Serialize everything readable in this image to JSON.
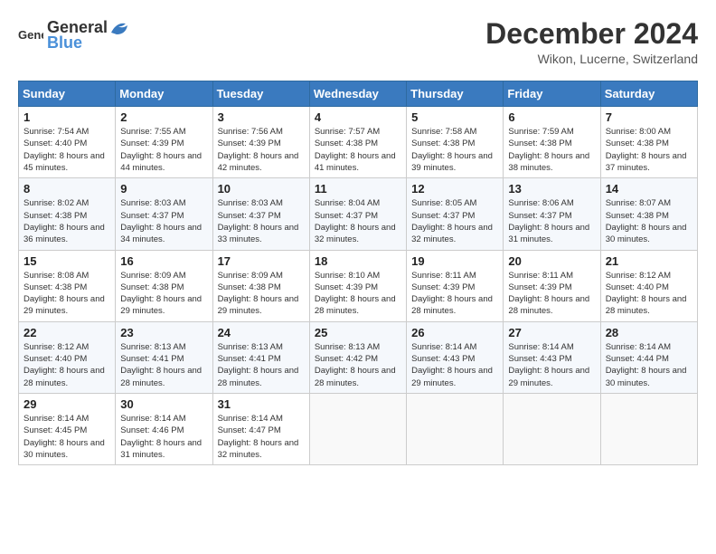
{
  "header": {
    "logo_general": "General",
    "logo_blue": "Blue",
    "month_title": "December 2024",
    "location": "Wikon, Lucerne, Switzerland"
  },
  "weekdays": [
    "Sunday",
    "Monday",
    "Tuesday",
    "Wednesday",
    "Thursday",
    "Friday",
    "Saturday"
  ],
  "weeks": [
    [
      {
        "day": "1",
        "sunrise": "7:54 AM",
        "sunset": "4:40 PM",
        "daylight": "8 hours and 45 minutes."
      },
      {
        "day": "2",
        "sunrise": "7:55 AM",
        "sunset": "4:39 PM",
        "daylight": "8 hours and 44 minutes."
      },
      {
        "day": "3",
        "sunrise": "7:56 AM",
        "sunset": "4:39 PM",
        "daylight": "8 hours and 42 minutes."
      },
      {
        "day": "4",
        "sunrise": "7:57 AM",
        "sunset": "4:38 PM",
        "daylight": "8 hours and 41 minutes."
      },
      {
        "day": "5",
        "sunrise": "7:58 AM",
        "sunset": "4:38 PM",
        "daylight": "8 hours and 39 minutes."
      },
      {
        "day": "6",
        "sunrise": "7:59 AM",
        "sunset": "4:38 PM",
        "daylight": "8 hours and 38 minutes."
      },
      {
        "day": "7",
        "sunrise": "8:00 AM",
        "sunset": "4:38 PM",
        "daylight": "8 hours and 37 minutes."
      }
    ],
    [
      {
        "day": "8",
        "sunrise": "8:02 AM",
        "sunset": "4:38 PM",
        "daylight": "8 hours and 36 minutes."
      },
      {
        "day": "9",
        "sunrise": "8:03 AM",
        "sunset": "4:37 PM",
        "daylight": "8 hours and 34 minutes."
      },
      {
        "day": "10",
        "sunrise": "8:03 AM",
        "sunset": "4:37 PM",
        "daylight": "8 hours and 33 minutes."
      },
      {
        "day": "11",
        "sunrise": "8:04 AM",
        "sunset": "4:37 PM",
        "daylight": "8 hours and 32 minutes."
      },
      {
        "day": "12",
        "sunrise": "8:05 AM",
        "sunset": "4:37 PM",
        "daylight": "8 hours and 32 minutes."
      },
      {
        "day": "13",
        "sunrise": "8:06 AM",
        "sunset": "4:37 PM",
        "daylight": "8 hours and 31 minutes."
      },
      {
        "day": "14",
        "sunrise": "8:07 AM",
        "sunset": "4:38 PM",
        "daylight": "8 hours and 30 minutes."
      }
    ],
    [
      {
        "day": "15",
        "sunrise": "8:08 AM",
        "sunset": "4:38 PM",
        "daylight": "8 hours and 29 minutes."
      },
      {
        "day": "16",
        "sunrise": "8:09 AM",
        "sunset": "4:38 PM",
        "daylight": "8 hours and 29 minutes."
      },
      {
        "day": "17",
        "sunrise": "8:09 AM",
        "sunset": "4:38 PM",
        "daylight": "8 hours and 29 minutes."
      },
      {
        "day": "18",
        "sunrise": "8:10 AM",
        "sunset": "4:39 PM",
        "daylight": "8 hours and 28 minutes."
      },
      {
        "day": "19",
        "sunrise": "8:11 AM",
        "sunset": "4:39 PM",
        "daylight": "8 hours and 28 minutes."
      },
      {
        "day": "20",
        "sunrise": "8:11 AM",
        "sunset": "4:39 PM",
        "daylight": "8 hours and 28 minutes."
      },
      {
        "day": "21",
        "sunrise": "8:12 AM",
        "sunset": "4:40 PM",
        "daylight": "8 hours and 28 minutes."
      }
    ],
    [
      {
        "day": "22",
        "sunrise": "8:12 AM",
        "sunset": "4:40 PM",
        "daylight": "8 hours and 28 minutes."
      },
      {
        "day": "23",
        "sunrise": "8:13 AM",
        "sunset": "4:41 PM",
        "daylight": "8 hours and 28 minutes."
      },
      {
        "day": "24",
        "sunrise": "8:13 AM",
        "sunset": "4:41 PM",
        "daylight": "8 hours and 28 minutes."
      },
      {
        "day": "25",
        "sunrise": "8:13 AM",
        "sunset": "4:42 PM",
        "daylight": "8 hours and 28 minutes."
      },
      {
        "day": "26",
        "sunrise": "8:14 AM",
        "sunset": "4:43 PM",
        "daylight": "8 hours and 29 minutes."
      },
      {
        "day": "27",
        "sunrise": "8:14 AM",
        "sunset": "4:43 PM",
        "daylight": "8 hours and 29 minutes."
      },
      {
        "day": "28",
        "sunrise": "8:14 AM",
        "sunset": "4:44 PM",
        "daylight": "8 hours and 30 minutes."
      }
    ],
    [
      {
        "day": "29",
        "sunrise": "8:14 AM",
        "sunset": "4:45 PM",
        "daylight": "8 hours and 30 minutes."
      },
      {
        "day": "30",
        "sunrise": "8:14 AM",
        "sunset": "4:46 PM",
        "daylight": "8 hours and 31 minutes."
      },
      {
        "day": "31",
        "sunrise": "8:14 AM",
        "sunset": "4:47 PM",
        "daylight": "8 hours and 32 minutes."
      },
      null,
      null,
      null,
      null
    ]
  ]
}
